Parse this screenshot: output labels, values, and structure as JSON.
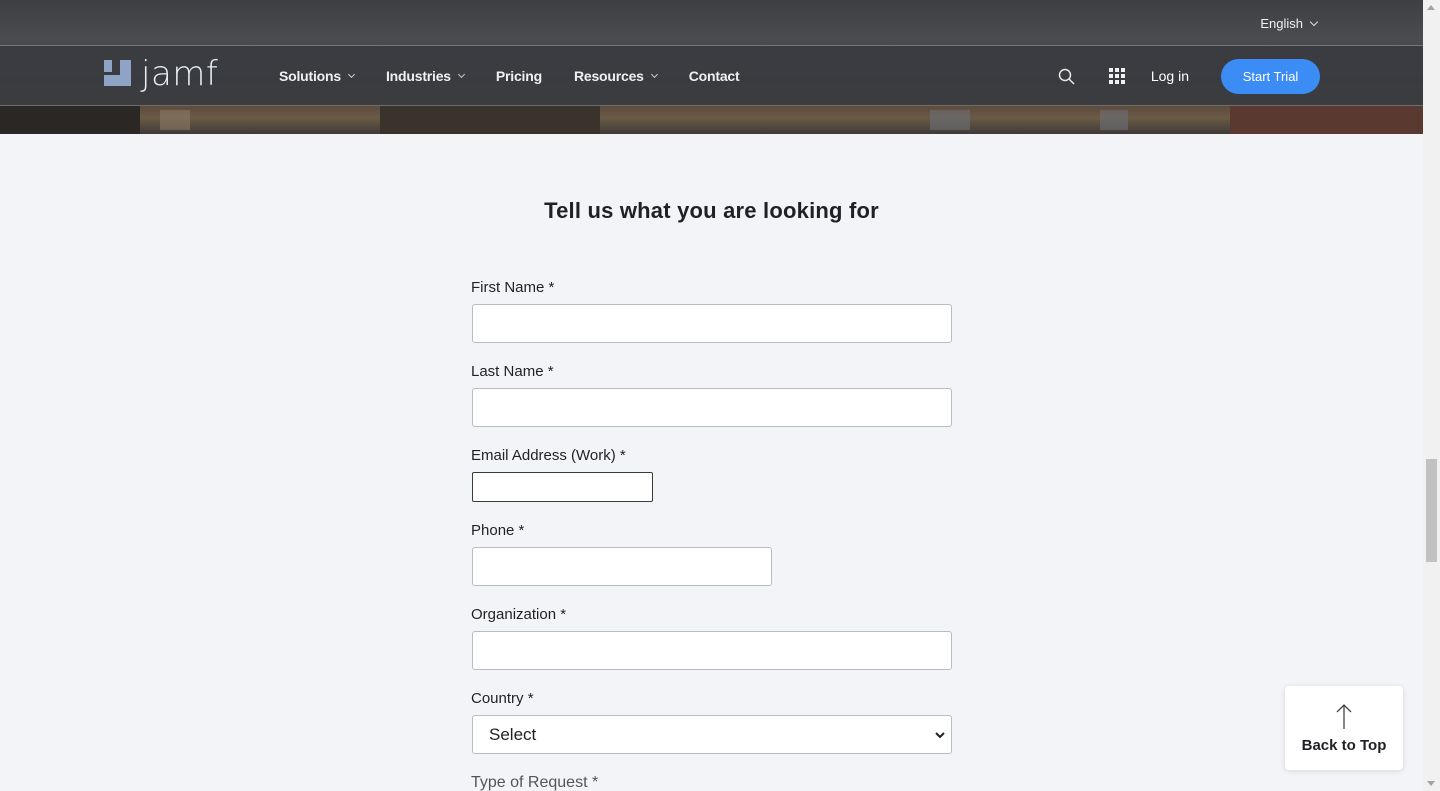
{
  "topbar": {
    "language": "English"
  },
  "brand": {
    "logo_text": "jamf"
  },
  "nav": {
    "items": [
      {
        "label": "Solutions",
        "dropdown": true
      },
      {
        "label": "Industries",
        "dropdown": true
      },
      {
        "label": "Pricing",
        "dropdown": false
      },
      {
        "label": "Resources",
        "dropdown": true
      },
      {
        "label": "Contact",
        "dropdown": false
      }
    ],
    "login": "Log in",
    "cta": "Start Trial",
    "icons": [
      "search-icon",
      "apps-grid-icon"
    ]
  },
  "form": {
    "heading": "Tell us what you are looking for",
    "first_name_label": "First Name *",
    "last_name_label": "Last Name *",
    "email_label": "Email Address (Work) *",
    "phone_label": "Phone *",
    "organization_label": "Organization *",
    "country_label": "Country *",
    "country_value": "Select",
    "request_type_label": "Type of Request *"
  },
  "back_to_top": {
    "label": "Back to Top"
  },
  "colors": {
    "accent": "#3b8cf5",
    "page_bg": "#f3f4f8",
    "nav_bg": "#3a3c40"
  }
}
